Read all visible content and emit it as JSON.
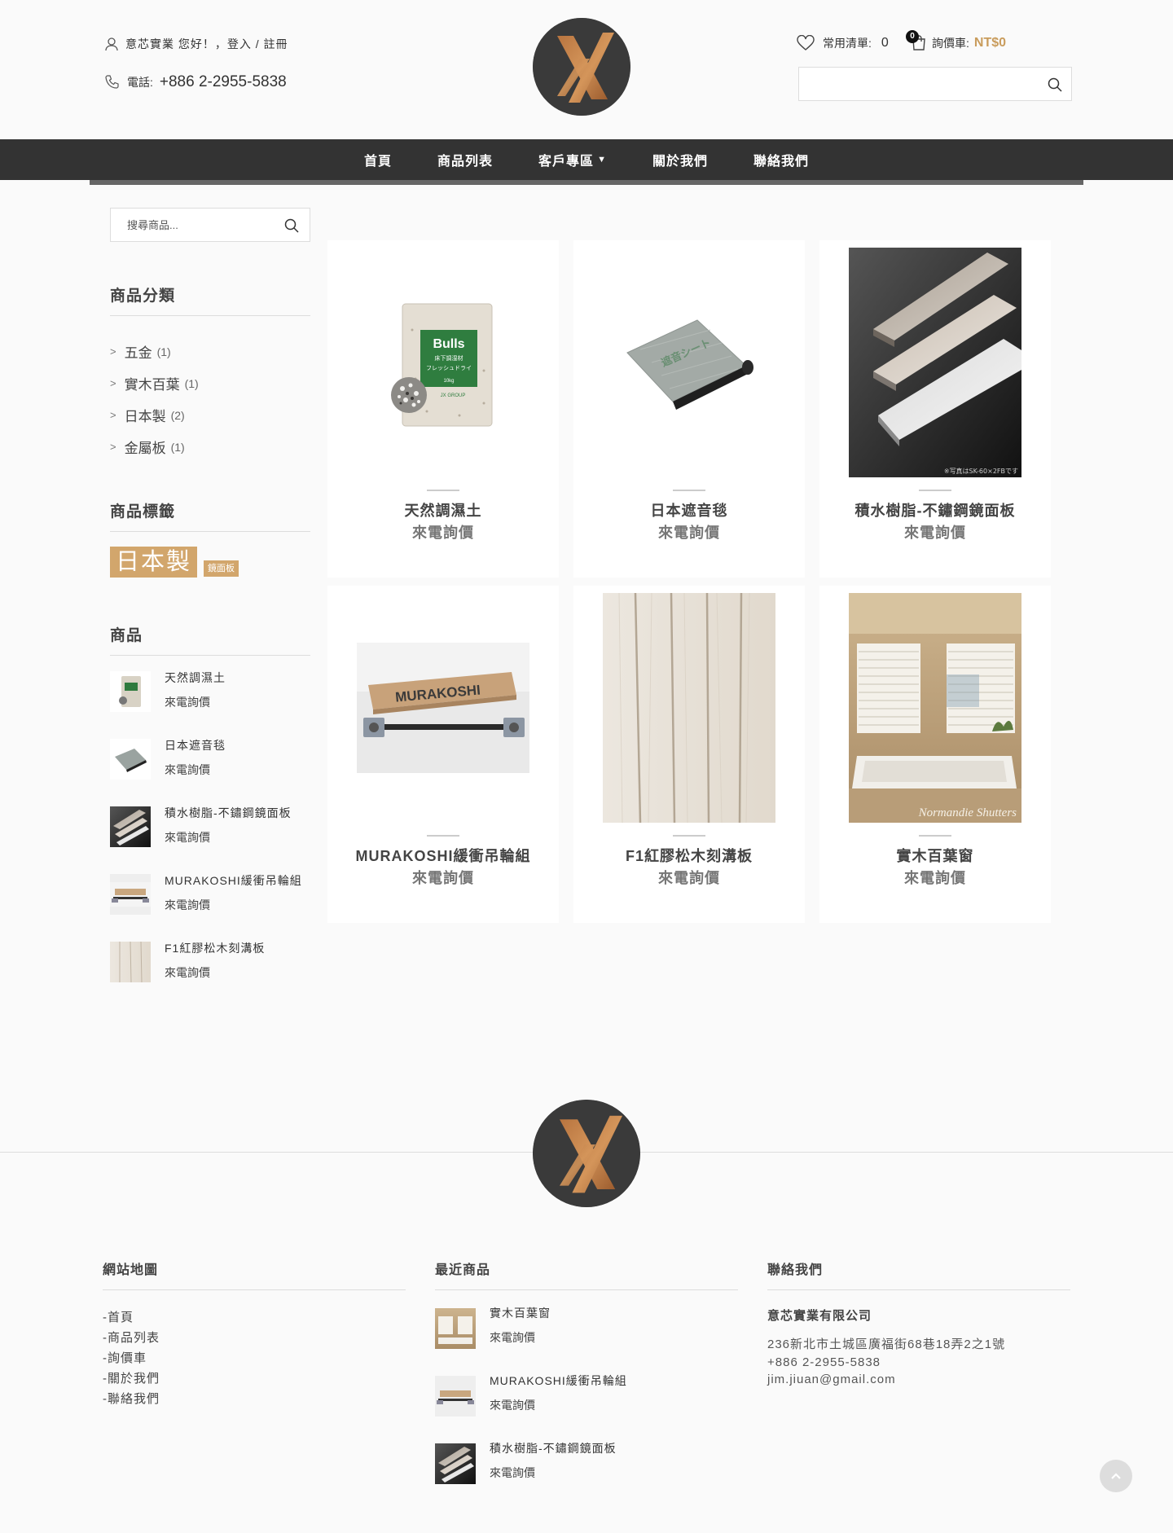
{
  "header": {
    "greeting": "意芯實業 您好！，登入 / 註冊",
    "phone_label": "電話:",
    "phone_number": "+886 2-2955-5838",
    "wishlist_label": "常用清單:",
    "wishlist_count": "0",
    "cart_badge": "0",
    "cart_label": "詢價車:",
    "cart_total": "NT$0",
    "search_placeholder": ""
  },
  "nav": {
    "items": [
      "首頁",
      "商品列表",
      "客戶專區",
      "關於我們",
      "聯絡我們"
    ]
  },
  "sidebar": {
    "search_placeholder": "搜尋商品...",
    "categories_title": "商品分類",
    "categories": [
      {
        "label": "五金",
        "count": "(1)"
      },
      {
        "label": "實木百葉",
        "count": "(1)"
      },
      {
        "label": "日本製",
        "count": "(2)"
      },
      {
        "label": "金屬板",
        "count": "(1)"
      }
    ],
    "tags_title": "商品標籤",
    "tags": [
      "日本製",
      "鏡面板"
    ],
    "products_title": "商品",
    "products": [
      {
        "name": "天然調濕土",
        "price": "來電詢價"
      },
      {
        "name": "日本遮音毯",
        "price": "來電詢價"
      },
      {
        "name": "積水樹脂-不鏽鋼鏡面板",
        "price": "來電詢價"
      },
      {
        "name": "MURAKOSHI緩衝吊輪組",
        "price": "來電詢價"
      },
      {
        "name": "F1紅膠松木刻溝板",
        "price": "來電詢價"
      }
    ]
  },
  "products": [
    {
      "name": "天然調濕土",
      "price": "來電詢價",
      "img_text": "Bulls",
      "img_sub": "床下調湿材",
      "img_sub2": "フレッシュドライ",
      "img_weight": "10kg",
      "img_brand": "JX GROUP"
    },
    {
      "name": "日本遮音毯",
      "price": "來電詢價",
      "img_text": "遮音シート"
    },
    {
      "name": "積水樹脂-不鏽鋼鏡面板",
      "price": "來電詢價",
      "img_caption": "※写真はSK-60×2FBです"
    },
    {
      "name": "MURAKOSHI緩衝吊輪組",
      "price": "來電詢價",
      "img_text": "MURAKOSHI"
    },
    {
      "name": "F1紅膠松木刻溝板",
      "price": "來電詢價"
    },
    {
      "name": "實木百葉窗",
      "price": "來電詢價",
      "img_caption": "Normandie Shutters"
    }
  ],
  "footer": {
    "sitemap_title": "網站地圖",
    "sitemap": [
      "-首頁",
      "-商品列表",
      "-詢價車",
      "-關於我們",
      "-聯絡我們"
    ],
    "recent_title": "最近商品",
    "recent": [
      {
        "name": "實木百葉窗",
        "price": "來電詢價"
      },
      {
        "name": "MURAKOSHI緩衝吊輪組",
        "price": "來電詢價"
      },
      {
        "name": "積水樹脂-不鏽鋼鏡面板",
        "price": "來電詢價"
      }
    ],
    "contact_title": "聯絡我們",
    "company": "意芯實業有限公司",
    "address": "236新北市土城區廣福街68巷18弄2之1號",
    "phone": "+886 2-2955-5838",
    "email": "jim.jiuan@gmail.com"
  },
  "colors": {
    "accent": "#c99c5c",
    "nav_bg": "#333333",
    "tag_bg": "#d2a66c"
  }
}
